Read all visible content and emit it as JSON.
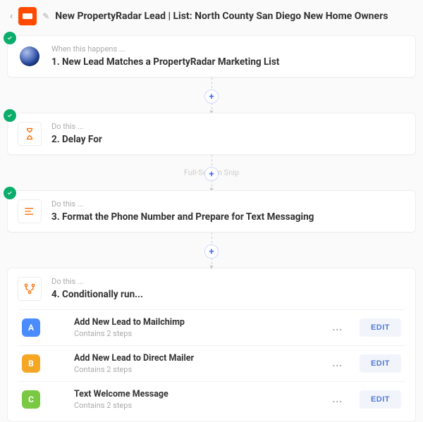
{
  "header": {
    "title": "New PropertyRadar Lead | List: North County San Diego New Home Owners"
  },
  "steps": [
    {
      "label": "When this happens ...",
      "title": "1. New Lead Matches a PropertyRadar Marketing List"
    },
    {
      "label": "Do this ...",
      "title": "2. Delay For"
    },
    {
      "label": "Do this ...",
      "title": "3. Format the Phone Number and Prepare for Text Messaging"
    }
  ],
  "multi": {
    "label": "Do this ...",
    "title": "4. Conditionally run...",
    "paths": [
      {
        "badge": "A",
        "title": "Add New Lead to Mailchimp",
        "sub": "Contains 2 steps",
        "edit": "EDIT"
      },
      {
        "badge": "B",
        "title": "Add New Lead to Direct Mailer",
        "sub": "Contains 2 steps",
        "edit": "EDIT"
      },
      {
        "badge": "C",
        "title": "Text Welcome Message",
        "sub": "Contains 2 steps",
        "edit": "EDIT"
      }
    ]
  },
  "ghost": "Full-Screen Snip"
}
